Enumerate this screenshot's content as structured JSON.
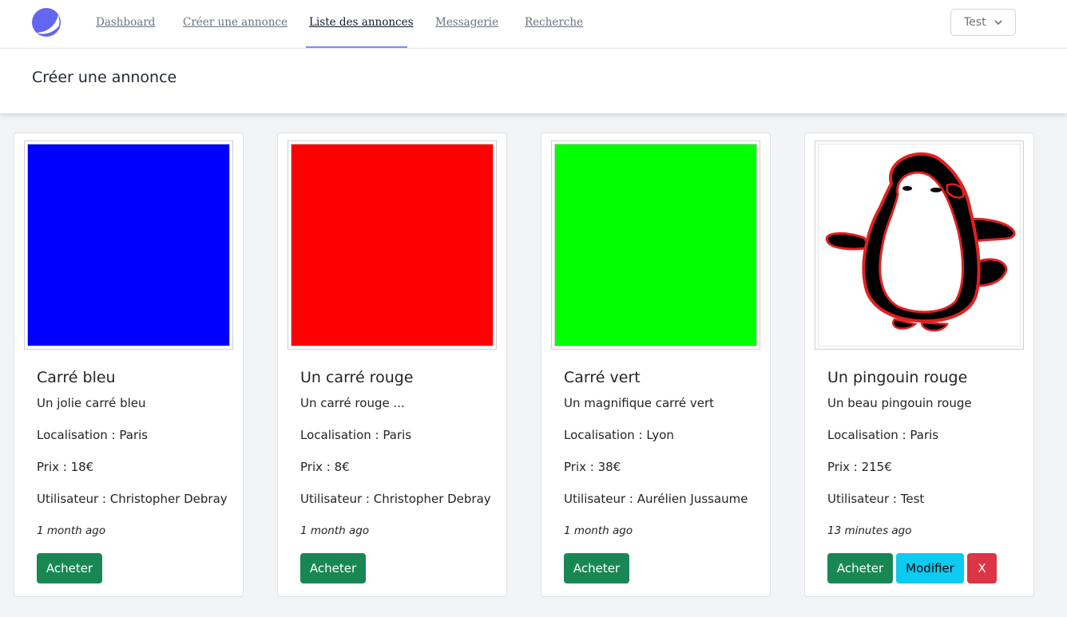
{
  "nav": {
    "links": [
      {
        "label": "Dashboard"
      },
      {
        "label": "Créer une annonce"
      },
      {
        "label": "Liste des annonces"
      },
      {
        "label": "Messagerie"
      },
      {
        "label": "Recherche"
      }
    ],
    "active_index": 2,
    "user": "Test",
    "accent_color": "#818cf8",
    "logo_icon": "crescent-logo-icon"
  },
  "header": {
    "title": "Créer une annonce"
  },
  "cards": [
    {
      "image": "blue-square",
      "image_color": "#0000ff",
      "title": "Carré bleu",
      "description": "Un jolie carré bleu",
      "location": "Localisation : Paris",
      "price": "Prix : 18€",
      "user": "Utilisateur : Christopher Debray",
      "time": "1 month ago",
      "buy_label": "Acheter"
    },
    {
      "image": "red-square",
      "image_color": "#ff0000",
      "title": "Un carré rouge",
      "description": "Un carré rouge ...",
      "location": "Localisation : Paris",
      "price": "Prix : 8€",
      "user": "Utilisateur : Christopher Debray",
      "time": "1 month ago",
      "buy_label": "Acheter"
    },
    {
      "image": "green-square",
      "image_color": "#00ff00",
      "title": "Carré vert",
      "description": "Un magnifique carré vert",
      "location": "Localisation : Lyon",
      "price": "Prix : 38€",
      "user": "Utilisateur : Aurélien Jussaume",
      "time": "1 month ago",
      "buy_label": "Acheter"
    },
    {
      "image": "red-penguin",
      "title": "Un pingouin rouge",
      "description": "Un beau pingouin rouge",
      "location": "Localisation : Paris",
      "price": "Prix : 215€",
      "user": "Utilisateur : Test",
      "time": "13 minutes ago",
      "buy_label": "Acheter",
      "edit_label": "Modifier",
      "delete_label": "X"
    }
  ],
  "colors": {
    "buy": "#198754",
    "edit": "#0dcaf0",
    "delete": "#dc3545"
  }
}
